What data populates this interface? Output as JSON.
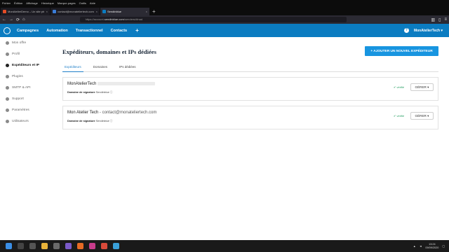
{
  "menubar": [
    "Fichier",
    "Édition",
    "Affichage",
    "Historique",
    "Marque-pages",
    "Outils",
    "Aide"
  ],
  "tabs": [
    {
      "label": "MonAtelierDemo – Un site ph",
      "color": "#e34c26"
    },
    {
      "label": "contact@monateliertech.com",
      "color": "#3b7dd8"
    },
    {
      "label": "Sendinblue",
      "color": "#0b7cc1"
    }
  ],
  "url": {
    "prefix": "https://account.",
    "host": "sendinblue.com",
    "path": "/senders/#inad"
  },
  "app": {
    "nav": [
      "Campagnes",
      "Automation",
      "Transactionnel",
      "Contacts"
    ],
    "plus": "+",
    "help": "?",
    "account": "MonAtelierTech ▾"
  },
  "sidebar": [
    {
      "label": "Mon offre"
    },
    {
      "label": "Profil"
    },
    {
      "label": "Expéditeurs et IP"
    },
    {
      "label": "Plugins"
    },
    {
      "label": "SMTP & API"
    },
    {
      "label": "Support"
    },
    {
      "label": "Paramètres"
    },
    {
      "label": "Utilisateurs"
    }
  ],
  "page": {
    "title": "Expéditeurs, domaines et IPs dédiées",
    "add_button": "+ AJOUTER UN NOUVEL EXPÉDITEUR",
    "tabs": [
      "Expéditeurs",
      "Domaines",
      "IPs dédiées"
    ]
  },
  "senders": [
    {
      "name": "MonAtelierTech",
      "email": "",
      "sig_label": "Domaine de signature",
      "sig_value": "Sendinblue ⓘ",
      "status": "✔ vérifié",
      "action": "GÉRER ▾"
    },
    {
      "name": "Mon Atelier Tech",
      "email": " - contact@monateliertech.com",
      "sig_label": "Domaine de signature",
      "sig_value": "Sendinblue ⓘ",
      "status": "✔ vérifié",
      "action": "GÉRER ▾"
    }
  ],
  "tray": {
    "time": "13:24",
    "date": "09/09/2020"
  }
}
